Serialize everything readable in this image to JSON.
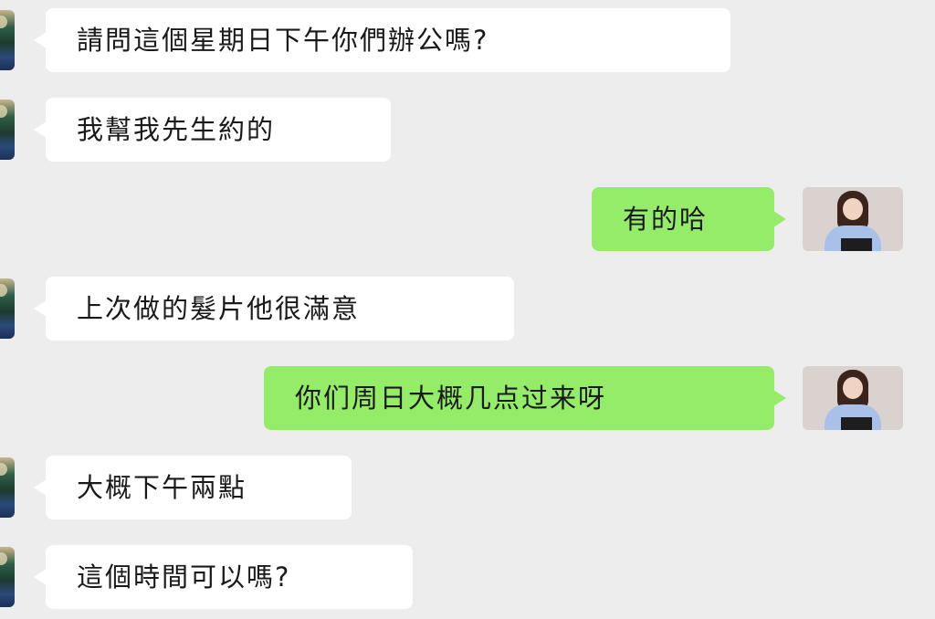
{
  "colors": {
    "background": "#ededed",
    "incoming_bubble": "#ffffff",
    "outgoing_bubble": "#95ec69",
    "text": "#1a1a1a"
  },
  "messages": [
    {
      "side": "in",
      "text": "請問這個星期日下午你們辦公嗎?"
    },
    {
      "side": "in",
      "text": "我幫我先生約的"
    },
    {
      "side": "out",
      "text": "有的哈"
    },
    {
      "side": "in",
      "text": "上次做的髮片他很滿意"
    },
    {
      "side": "out",
      "text": "你们周日大概几点过来呀"
    },
    {
      "side": "in",
      "text": "大概下午兩點"
    },
    {
      "side": "in",
      "text": "這個時間可以嗎?"
    }
  ]
}
